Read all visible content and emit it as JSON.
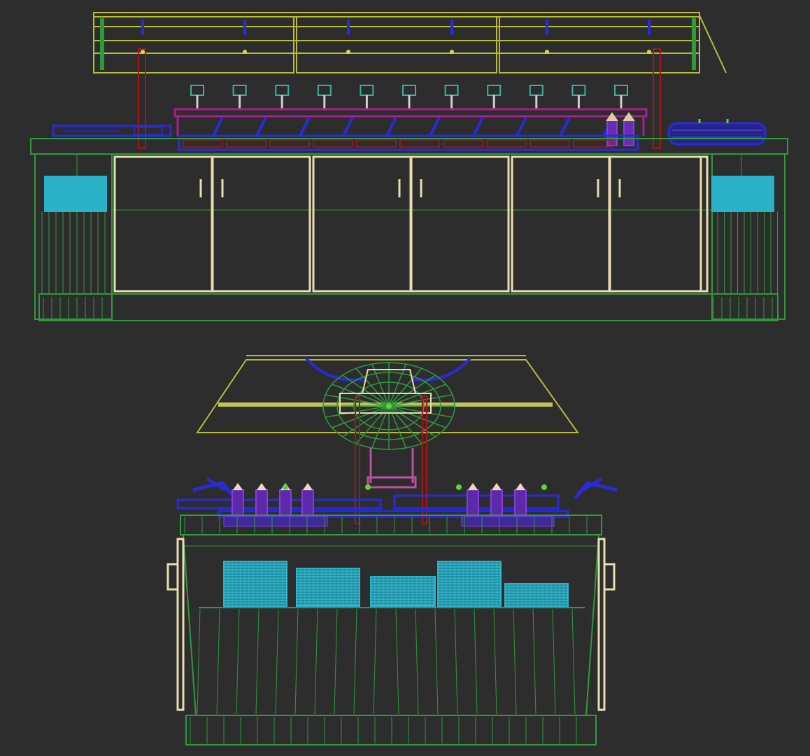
{
  "viewport": {
    "background": "#2d2d2d",
    "views": [
      {
        "id": "front",
        "label": ""
      },
      {
        "id": "side",
        "label": ""
      }
    ]
  },
  "colors": {
    "yellow": "#b8bb3a",
    "yellow_bright": "#d4d84a",
    "green": "#2f9a3c",
    "green_bright": "#5fd13a",
    "cream": "#e9ddb0",
    "blue": "#2a2bd8",
    "violet": "#8a3bd8",
    "magenta": "#a81d8f",
    "red": "#a41818",
    "cyan": "#2ab2c8",
    "teal": "#3ab0a0"
  },
  "objects": {
    "sneeze_guard_count": 3,
    "cabinet_door_count": 6,
    "lamp_count": 11,
    "plate_stack_count": 5
  }
}
